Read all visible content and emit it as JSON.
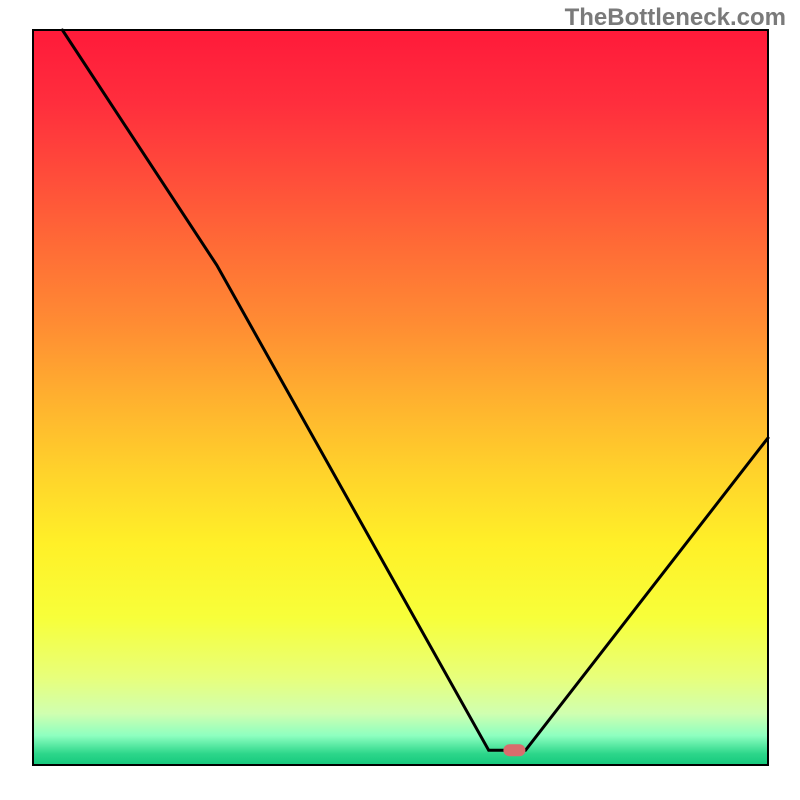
{
  "watermark": "TheBottleneck.com",
  "chart_data": {
    "type": "line",
    "title": "",
    "xlabel": "",
    "ylabel": "",
    "xlim": [
      0,
      100
    ],
    "ylim": [
      0,
      100
    ],
    "axes_visible": false,
    "curve_points": [
      {
        "x": 4.0,
        "y": 100.0
      },
      {
        "x": 25.0,
        "y": 68.0
      },
      {
        "x": 62.0,
        "y": 2.0
      },
      {
        "x": 67.0,
        "y": 2.0
      },
      {
        "x": 100.0,
        "y": 44.5
      }
    ],
    "marker": {
      "x": 65.5,
      "y": 2.0,
      "color": "#d96d6d",
      "shape": "rounded-rect"
    },
    "background": {
      "gradient_stops": [
        {
          "pos": 0.0,
          "color": "#ff1a3a"
        },
        {
          "pos": 0.1,
          "color": "#ff2e3d"
        },
        {
          "pos": 0.2,
          "color": "#ff4d3a"
        },
        {
          "pos": 0.3,
          "color": "#ff6d36"
        },
        {
          "pos": 0.4,
          "color": "#ff8c33"
        },
        {
          "pos": 0.5,
          "color": "#ffb02f"
        },
        {
          "pos": 0.6,
          "color": "#ffd22b"
        },
        {
          "pos": 0.7,
          "color": "#fff028"
        },
        {
          "pos": 0.8,
          "color": "#f7ff3a"
        },
        {
          "pos": 0.88,
          "color": "#e8ff7a"
        },
        {
          "pos": 0.93,
          "color": "#d0ffb0"
        },
        {
          "pos": 0.96,
          "color": "#8effc0"
        },
        {
          "pos": 0.985,
          "color": "#2cd68a"
        },
        {
          "pos": 1.0,
          "color": "#15c87c"
        }
      ]
    },
    "frame": {
      "stroke": "#000000",
      "width": 2
    }
  }
}
